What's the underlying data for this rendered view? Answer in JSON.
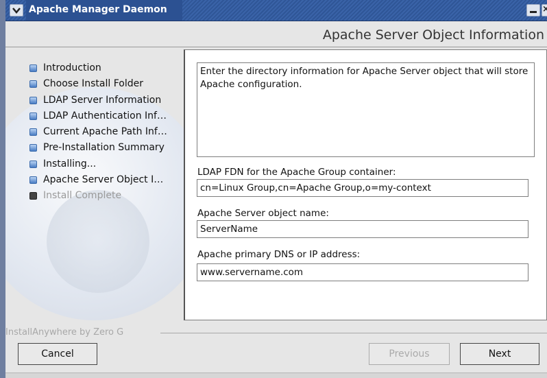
{
  "window": {
    "title": "Apache Manager Daemon",
    "close_glyph": "×"
  },
  "header": {
    "page_title": "Apache Server Object Information"
  },
  "steps": [
    {
      "label": "Introduction",
      "state": "done"
    },
    {
      "label": "Choose Install Folder",
      "state": "done"
    },
    {
      "label": "LDAP Server Information",
      "state": "done"
    },
    {
      "label": "LDAP Authentication Inf…",
      "state": "done"
    },
    {
      "label": "Current Apache Path Inf…",
      "state": "done"
    },
    {
      "label": "Pre-Installation Summary",
      "state": "done"
    },
    {
      "label": "Installing...",
      "state": "done"
    },
    {
      "label": "Apache Server Object I…",
      "state": "current"
    },
    {
      "label": "Install Complete",
      "state": "disabled"
    }
  ],
  "content": {
    "description": "Enter the directory information for Apache Server object that will store Apache configuration.",
    "fields": [
      {
        "label": "LDAP FDN for the Apache Group container:",
        "value": "cn=Linux Group,cn=Apache Group,o=my-context"
      },
      {
        "label": "Apache Server object name:",
        "value": "ServerName"
      },
      {
        "label": "Apache primary DNS or IP address:",
        "value": "www.servername.com"
      }
    ]
  },
  "footer": {
    "brand": "InstallAnywhere by Zero G",
    "cancel_label": "Cancel",
    "previous_label": "Previous",
    "next_label": "Next"
  },
  "icons": {
    "menu": "chevron-down-icon",
    "minimize": "minimize-icon",
    "close": "close-icon",
    "step_bullet": "step-bullet-icon"
  },
  "colors": {
    "titlebar": "#2f5697",
    "step_bullet": "#4a7dc4"
  }
}
